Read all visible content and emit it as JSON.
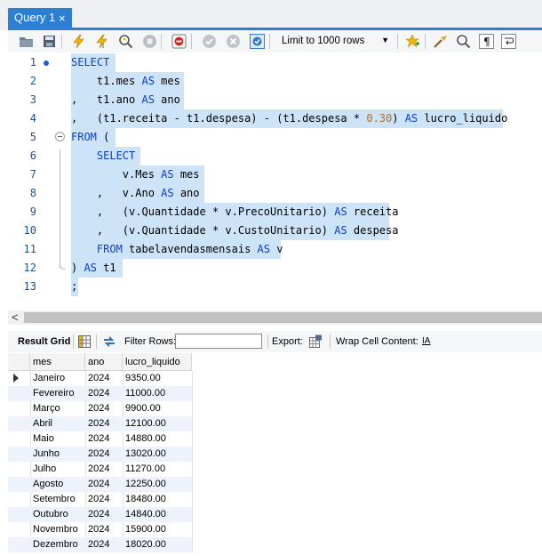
{
  "tab": {
    "title": "Query 1",
    "close": "×"
  },
  "toolbar": {
    "limit_label": "Limit to 1000 rows",
    "icons": [
      "open-file-icon",
      "save-icon",
      "execute-icon",
      "execute-current-icon",
      "explain-icon",
      "stop-icon",
      "toggle-error-stop-icon",
      "commit-icon",
      "rollback-icon",
      "autocommit-icon",
      "add-snippet-icon",
      "beautify-icon",
      "find-icon",
      "invisible-chars-icon",
      "wrap-icon"
    ]
  },
  "editor": {
    "lines": [
      {
        "n": "1"
      },
      {
        "n": "2"
      },
      {
        "n": "3"
      },
      {
        "n": "4"
      },
      {
        "n": "5"
      },
      {
        "n": "6"
      },
      {
        "n": "7"
      },
      {
        "n": "8"
      },
      {
        "n": "9"
      },
      {
        "n": "10"
      },
      {
        "n": "11"
      },
      {
        "n": "12"
      },
      {
        "n": "13"
      }
    ],
    "tokens": {
      "l1": [
        "SELECT"
      ],
      "l2": [
        "    t1.mes ",
        "AS",
        " mes"
      ],
      "l3": [
        ",   t1.ano ",
        "AS",
        " ano"
      ],
      "l4": [
        ",   (t1.receita - t1.despesa) - (t1.despesa * ",
        "0.30",
        ") ",
        "AS",
        " lucro_liquido"
      ],
      "l5": [
        "FROM",
        " ("
      ],
      "l6": [
        "    SELECT"
      ],
      "l7": [
        "        v.Mes ",
        "AS",
        " mes"
      ],
      "l8": [
        "    ,   v.Ano ",
        "AS",
        " ano"
      ],
      "l9": [
        "    ,   (v.Quantidade * v.PrecoUnitario) ",
        "AS",
        " receita"
      ],
      "l10": [
        "    ,   (v.Quantidade * v.CustoUnitario) ",
        "AS",
        " despesa"
      ],
      "l11": [
        "    FROM",
        " tabelavendasmensais ",
        "AS",
        " v"
      ],
      "l12": [
        ") ",
        "AS",
        " t1"
      ],
      "l13": [
        ";"
      ]
    }
  },
  "scroll": {
    "left_arrow": "<"
  },
  "result_toolbar": {
    "result_grid": "Result Grid",
    "filter_rows": "Filter Rows:",
    "filter_value": "",
    "export": "Export:",
    "wrap_cell": "Wrap Cell Content:",
    "wrap_glyph": "IA"
  },
  "grid": {
    "columns": [
      "mes",
      "ano",
      "lucro_liquido"
    ],
    "rows": [
      [
        "Janeiro",
        "2024",
        "9350.00"
      ],
      [
        "Fevereiro",
        "2024",
        "11000.00"
      ],
      [
        "Março",
        "2024",
        "9900.00"
      ],
      [
        "Abril",
        "2024",
        "12100.00"
      ],
      [
        "Maio",
        "2024",
        "14880.00"
      ],
      [
        "Junho",
        "2024",
        "13020.00"
      ],
      [
        "Julho",
        "2024",
        "11270.00"
      ],
      [
        "Agosto",
        "2024",
        "12250.00"
      ],
      [
        "Setembro",
        "2024",
        "18480.00"
      ],
      [
        "Outubro",
        "2024",
        "14840.00"
      ],
      [
        "Novembro",
        "2024",
        "15900.00"
      ],
      [
        "Dezembro",
        "2024",
        "18020.00"
      ]
    ]
  },
  "colors": {
    "accent": "#2d7fd5",
    "selection": "#cde3f8",
    "keyword": "#0a3cd6",
    "number": "#b3711d",
    "line_number": "#1b4f91"
  }
}
